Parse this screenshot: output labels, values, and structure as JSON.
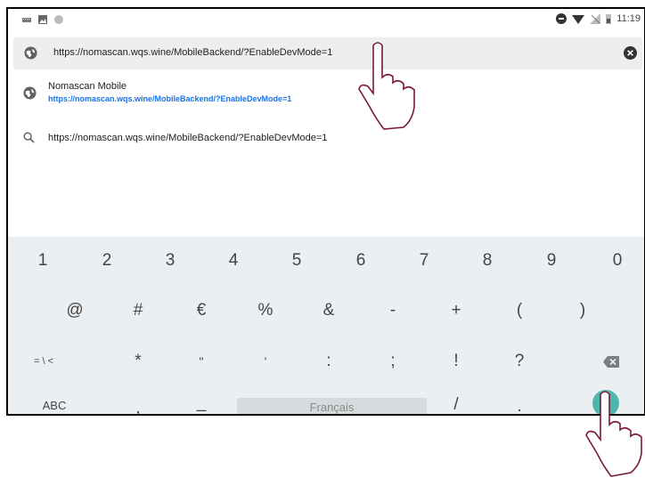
{
  "statusbar": {
    "time": "11:19"
  },
  "url_bar": {
    "value": "https://nomascan.wqs.wine/MobileBackend/?EnableDevMode=1"
  },
  "suggestions": [
    {
      "title": "Nomascan Mobile",
      "url": "https://nomascan.wqs.wine/MobileBackend/?EnableDevMode=1",
      "icon": "globe-icon"
    },
    {
      "title": "https://nomascan.wqs.wine/MobileBackend/?EnableDevMode=1",
      "icon": "search-icon"
    }
  ],
  "keyboard": {
    "row1": [
      "1",
      "2",
      "3",
      "4",
      "5",
      "6",
      "7",
      "8",
      "9",
      "0"
    ],
    "row2": [
      "@",
      "#",
      "€",
      "%",
      "&",
      "-",
      "+",
      "(",
      ")"
    ],
    "row3": [
      "= \\ <",
      "*",
      "\"",
      "'",
      ":",
      ";",
      "!",
      "?"
    ],
    "abc": "ABC",
    "comma": ",",
    "underscore": "_",
    "space": "Français",
    "slash": "/",
    "period": ".",
    "accent_color": "#4db6ac"
  }
}
